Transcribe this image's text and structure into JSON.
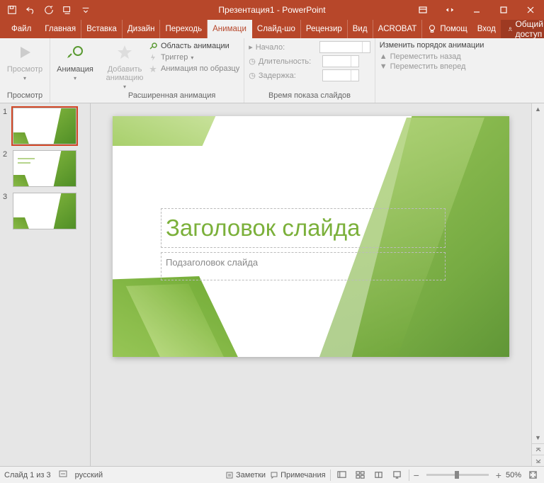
{
  "titlebar": {
    "title": "Презентация1 - PowerPoint"
  },
  "tabs": {
    "file": "Файл",
    "items": [
      "Главная",
      "Вставка",
      "Дизайн",
      "Переходь",
      "Анимаци",
      "Слайд-шо",
      "Рецензир",
      "Вид",
      "ACROBAT"
    ],
    "active": "Анимаци",
    "help": "Помощ",
    "signin": "Вход",
    "share": "Общий доступ"
  },
  "ribbon": {
    "preview": {
      "btn": "Просмотр",
      "group": "Просмотр"
    },
    "animation": {
      "btn": "Анимация"
    },
    "addAnim": {
      "btn": "Добавить анимацию"
    },
    "advanced": {
      "pane": "Область анимации",
      "trigger": "Триггер",
      "painter": "Анимация по образцу",
      "group": "Расширенная анимация"
    },
    "timing": {
      "start": "Начало:",
      "duration": "Длительность:",
      "delay": "Задержка:",
      "group": "Время показа слайдов"
    },
    "reorder": {
      "header": "Изменить порядок анимации",
      "back": "Переместить назад",
      "fwd": "Переместить вперед"
    }
  },
  "thumbs": [
    "1",
    "2",
    "3"
  ],
  "slide": {
    "title": "Заголовок слайда",
    "subtitle": "Подзаголовок слайда"
  },
  "status": {
    "slide": "Слайд 1 из 3",
    "lang": "русский",
    "notes": "Заметки",
    "comments": "Примечания",
    "zoom": "50%"
  }
}
